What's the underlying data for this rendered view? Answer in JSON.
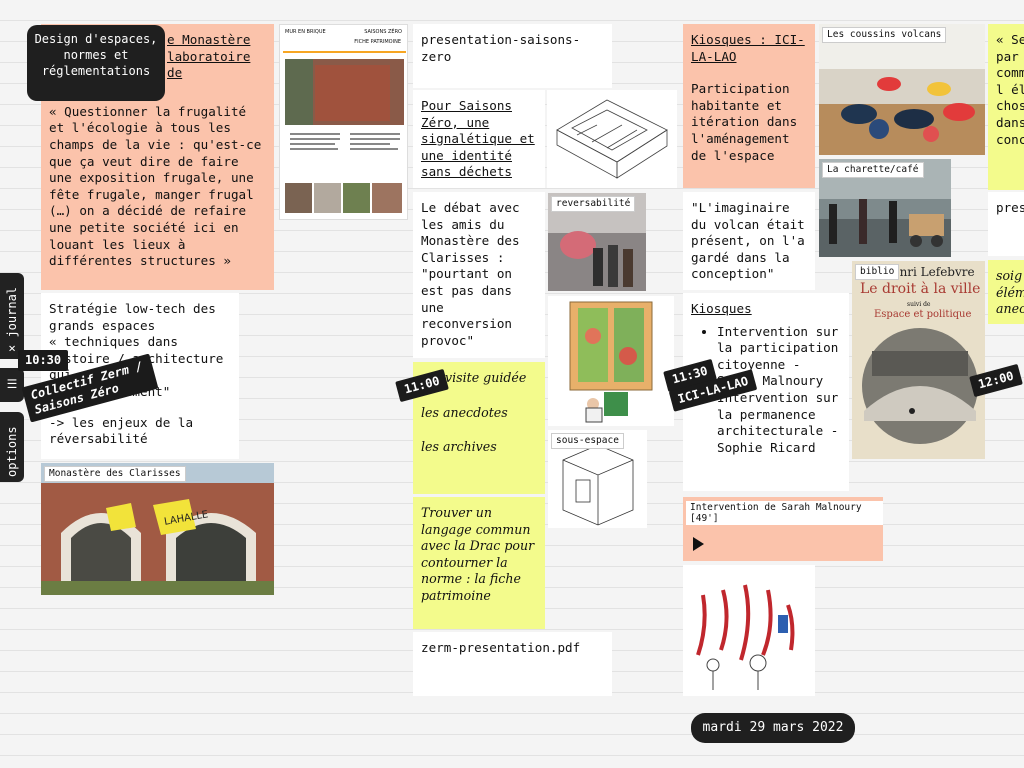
{
  "side": {
    "journal": "× journal",
    "menu": "☰",
    "options": "options"
  },
  "tag_design": "Design d'espaces, normes et réglementations",
  "cards": {
    "monastere_title": "e Monastère laboratoire de",
    "monastere_quote": "« Questionner la frugalité et l'écologie à tous les champs de la vie : qu'est-ce que ça veut dire de faire une exposition frugale, une fête frugale, manger frugal (…) on a décidé de refaire une petite société ici en louant les lieux à différentes structures »",
    "lowtech": "Stratégie low-tech des grands espaces",
    "lowtech_quote": "« techniques dans histoire / architecture qui ont été progressivement\"",
    "lowtech_enjeux": "-> les enjeux de la réversabilité",
    "presentation": "presentation-saisons-zero",
    "signaletique": "Pour Saisons Zéro, une signalétique et une identité sans déchets",
    "debat": "Le débat avec les amis du Monastère des Clarisses : \"pourtant on est pas dans une reconversion provoc\"",
    "visite": [
      "visite guidée",
      "les anecdotes",
      "les archives"
    ],
    "langage": "Trouver un langage commun avec la Drac pour contourner la norme : la fiche patrimoine",
    "pdf": "zerm-presentation.pdf",
    "kiosques_title": "Kiosques : ICI-LA-LAO",
    "kiosques_body": "Participation habitante et itération dans l'aménagement de l'espace",
    "imaginaire": "\"L'imaginaire du volcan était présent, on l'a gardé dans la conception\"",
    "kiosques2_title": "Kiosques",
    "kiosques2_items": [
      "Intervention sur la participation citoyenne - Sarah Malnoury",
      "Intervention sur la permanence architecturale - Sophie Ricard"
    ],
    "audio_label": "Intervention de Sarah Malnoury [49']",
    "right_partial": "« Se par comm du l élém chos dans conc",
    "pres_partial": "pres",
    "soig_partial": "soig élém anec"
  },
  "captions": {
    "clarisses": "Monastère des Clarisses",
    "reversabilite": "reversabilité",
    "sous_espace": "sous-espace",
    "coussins": "Les coussins volcans",
    "charette": "La charette/café",
    "biblio": "biblio"
  },
  "book": {
    "author": "Henri Lefebvre",
    "title": "Le droit à la ville",
    "sub": "suivi de",
    "sub2": "Espace et politique"
  },
  "signs": {
    "lahalle": "LAHALLE"
  },
  "doc": {
    "header_left": "MUR EN BRIQUE",
    "header_right": "SAISONS ZÉRO",
    "label": "FICHE PATRIMOINE"
  },
  "stamps": {
    "s1030_time": "10:30",
    "s1030_text": "Collectif Zerm / Saisons Zéro",
    "s1100": "11:00",
    "s1130_time": "11:30",
    "s1130_text": "ICI-LA-LAO",
    "s1200": "12:00"
  },
  "date": "mardi 29 mars 2022",
  "colors": {
    "salmon": "#fbc3ab",
    "yellow": "#f3fb8c",
    "dark": "#1f1f1f"
  }
}
